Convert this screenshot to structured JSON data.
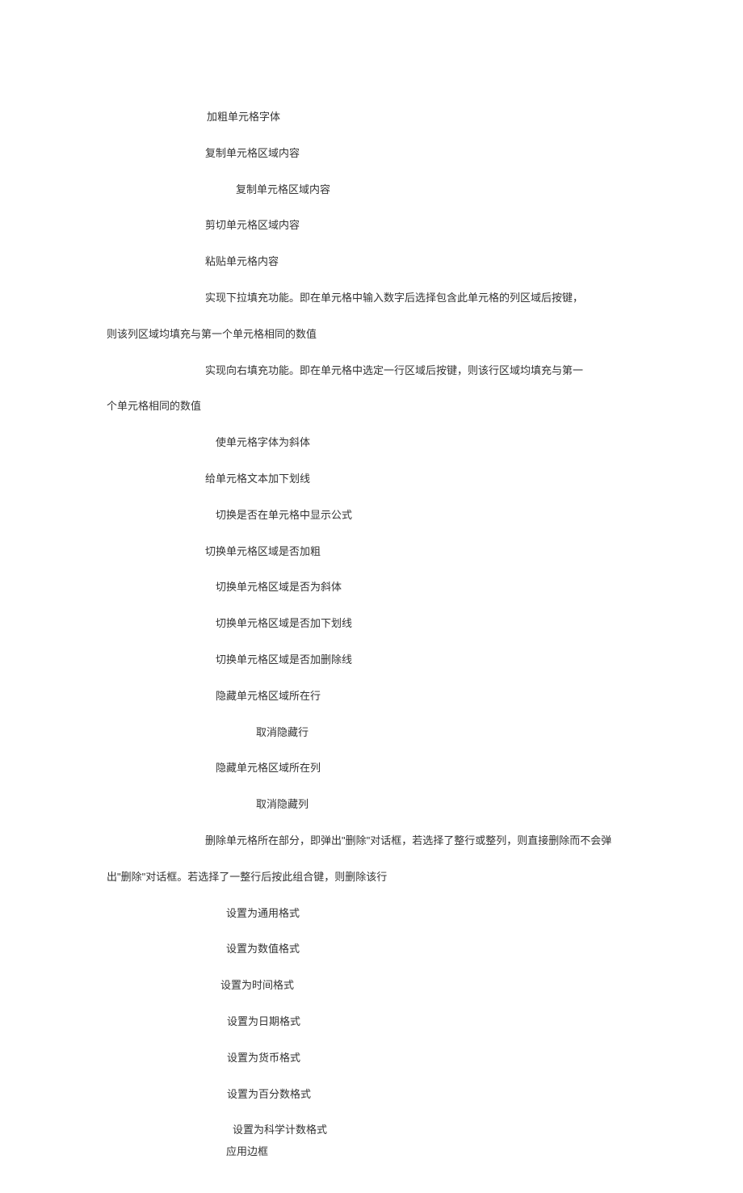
{
  "lines": {
    "bold_cell": "加粗单元格字体",
    "copy_region": "复制单元格区域内容",
    "copy_nested": "复制单元格区域内容",
    "cut_region": "剪切单元格区域内容",
    "paste_cell": "粘贴单元格内容",
    "fill_down_1": "实现下拉填充功能。即在单元格中输入数字后选择包含此单元格的列区域后按键，",
    "fill_down_2": "则该列区域均填充与第一个单元格相同的数值",
    "fill_right_1": "实现向右填充功能。即在单元格中选定一行区域后按键，则该行区域均填充与第一",
    "fill_right_2": "个单元格相同的数值",
    "italic_cell": "使单元格字体为斜体",
    "underline_cell": "给单元格文本加下划线",
    "formula_toggle": "切换是否在单元格中显示公式",
    "bold_toggle": "切换单元格区域是否加粗",
    "italic_toggle": "切换单元格区域是否为斜体",
    "underline_toggle": "切换单元格区域是否加下划线",
    "strike_toggle": "切换单元格区域是否加删除线",
    "hide_row": "隐藏单元格区域所在行",
    "unhide_row": "取消隐藏行",
    "hide_col": "隐藏单元格区域所在列",
    "unhide_col": "取消隐藏列",
    "delete_part_1": "删除单元格所在部分，即弹出\"删除\"对话框，若选择了整行或整列，则直接删除而不会弹",
    "delete_part_2": "出\"删除\"对话框。若选择了一整行后按此组合键，则删除该行",
    "format_general": "设置为通用格式",
    "format_number": "设置为数值格式",
    "format_time": "设置为时间格式",
    "format_date": "设置为日期格式",
    "format_currency": "设置为货币格式",
    "format_percent": "设置为百分数格式",
    "format_sci": "设置为科学计数格式",
    "apply_border": "应用边框"
  }
}
